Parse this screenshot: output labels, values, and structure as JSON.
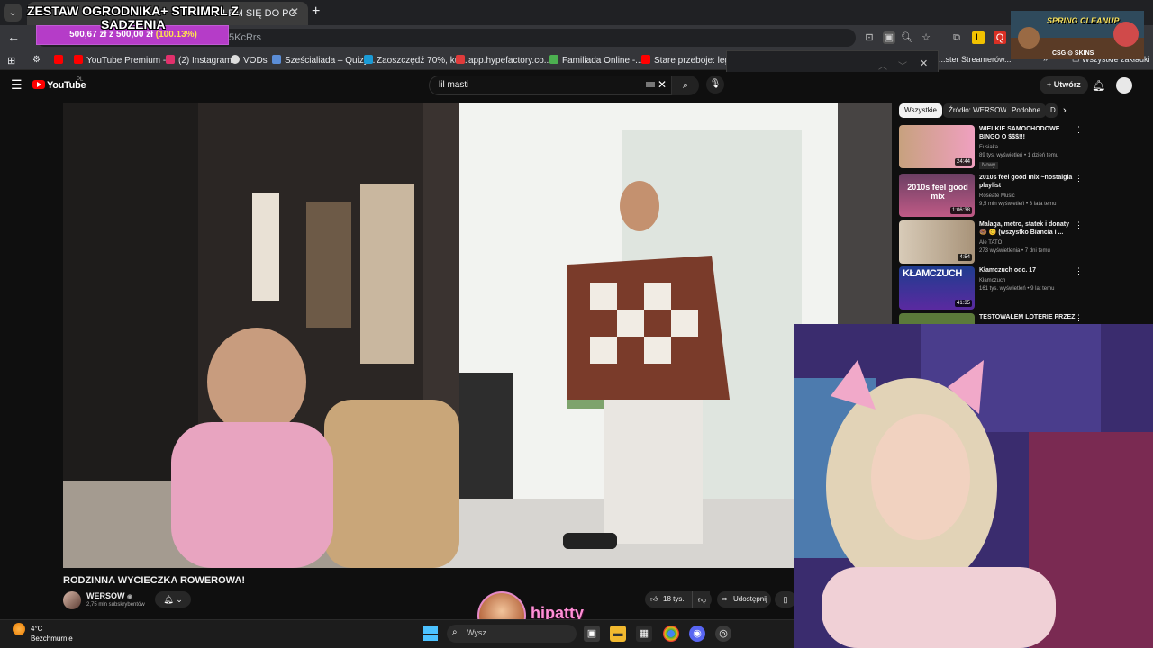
{
  "browser": {
    "tab_title": "...LEM SIĘ DO PO",
    "url_fragment": "5KcRrs",
    "bookmarks": [
      {
        "label": "YouTube Premium -...",
        "color": "#ff0000"
      },
      {
        "label": "(2) Instagram",
        "color": "#e1306c"
      },
      {
        "label": "VODs",
        "color": "#ffffff"
      },
      {
        "label": "Sześcialiada – Quizy...",
        "color": "#5b8dd6"
      },
      {
        "label": "Zaoszczędź 70%, ku...",
        "color": "#1b9bd6"
      },
      {
        "label": "app.hypefactory.co...",
        "color": "#e03b3b"
      },
      {
        "label": "Familiada Online -...",
        "color": "#4caf50"
      },
      {
        "label": "Stare przeboje: lege...",
        "color": "#ff0000"
      }
    ],
    "bookmark_more": "...ster Streamerów...",
    "all_bookmarks": "Wszystkie zakładki"
  },
  "youtube": {
    "logo": "YouTube",
    "region": "PL",
    "search_query": "lil masti",
    "create_label": "Utwórz",
    "chips": [
      "Wszystkie",
      "Źródło: WERSOW",
      "Podobne",
      "D"
    ],
    "video": {
      "title": "RODZINNA WYCIECZKA ROWEROWA!",
      "channel": "WERSOW",
      "subscribers": "2,75 mln subskrybentów",
      "likes": "18 tys.",
      "share_label": "Udostępnij"
    },
    "recommendations": [
      {
        "title": "WIELKIE SAMOCHODOWE BINGO O $$$!!!",
        "channel": "Fusiaka",
        "meta": "89 tys. wyświetleń • 1 dzień temu",
        "duration": "24:44",
        "badge": "Nowy"
      },
      {
        "title": "2010s feel good mix ~nostalgia playlist",
        "channel": "Roseate Music",
        "meta": "9,5 mln wyświetleń • 3 lata temu",
        "duration": "1:06:38",
        "thumb_text": "2010s feel good mix"
      },
      {
        "title": "Malaga, metro, statek i donaty 🍩 😊 (wszystko Biancia i ...",
        "channel": "Ale TATO",
        "meta": "273 wyświetlenia • 7 dni temu",
        "duration": "4:54"
      },
      {
        "title": "Kłamczuch odc. 17",
        "channel": "Kłamczuch",
        "meta": "161 tys. wyświetleń • 9 lat temu",
        "duration": "41:35",
        "thumb_text": "KŁAMCZUCH"
      },
      {
        "title": "TESTOWAŁEM LOTERIE PRZEZ",
        "channel": "",
        "meta": "",
        "duration": ""
      }
    ]
  },
  "overlay": {
    "goal_title_line1": "ZESTAW OGRODNIKA+ STRIMRL Z",
    "goal_title_line2": "SADZENIA",
    "goal_amount": "500,67 zł",
    "goal_sep": "z",
    "goal_target": "500,00 zł",
    "goal_percent": "(100.13%)",
    "goal_progress": 1.0,
    "sponsor_title": "SPRING CLEANUP",
    "sponsor_label": "CSG ⊙ SKINS",
    "streamer_name": "hipatty"
  },
  "taskbar": {
    "temperature": "4°C",
    "weather": "Bezchmurnie",
    "search_placeholder": "Wysz"
  }
}
